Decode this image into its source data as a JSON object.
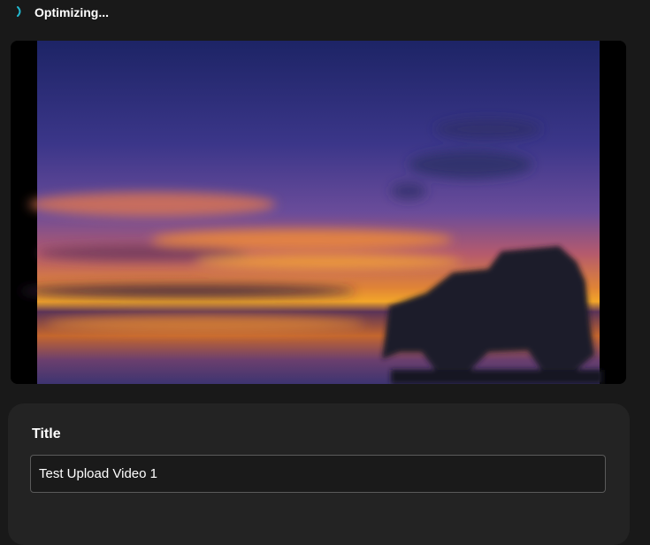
{
  "status": {
    "text": "Optimizing...",
    "icon": "spinner-icon",
    "accent_color": "#22b8cf"
  },
  "preview": {
    "icon": "video-thumbnail"
  },
  "form": {
    "title_label": "Title",
    "title_value": "Test Upload Video 1"
  }
}
